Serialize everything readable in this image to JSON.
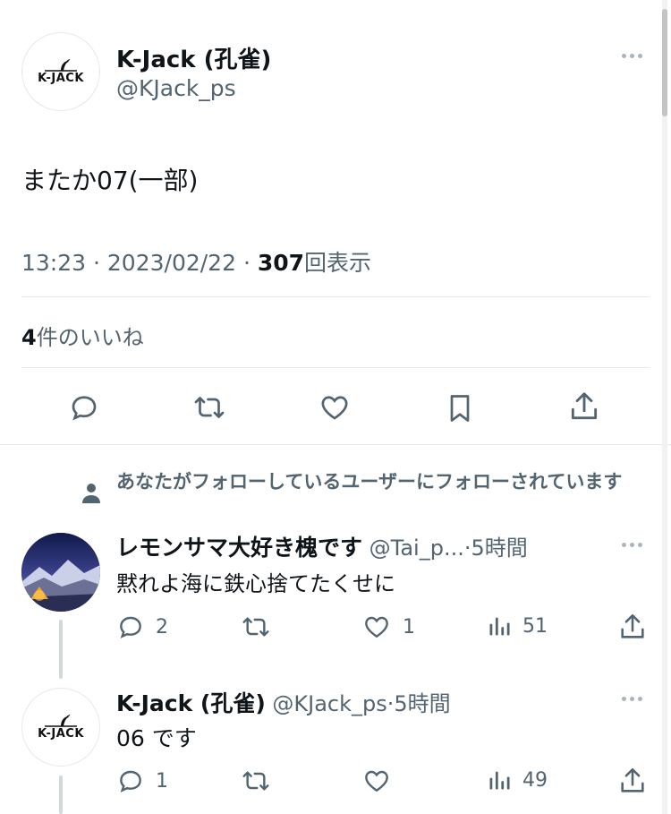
{
  "tweet": {
    "author_name": "K-Jack (孔雀)",
    "author_handle": "@KJack_ps",
    "avatar_logo_text": "K-JACK",
    "text": "またか07(一部)",
    "time": "13:23",
    "date": "2023/02/22",
    "views_count": "307",
    "views_label": "回表示",
    "separator": "·",
    "likes_count": "4",
    "likes_label": "件のいいね"
  },
  "replies": [
    {
      "context": "あなたがフォローしているユーザーにフォローされています",
      "author_name": "レモンサマ大好き槐です",
      "author_handle": "@Tai_p...",
      "separator": "·",
      "time_ago": "5時間",
      "text": "黙れよ海に鉄心捨てたくせに",
      "reply_count": "2",
      "like_count": "1",
      "view_count": "51"
    },
    {
      "author_name": "K-Jack (孔雀)",
      "author_handle": "@KJack_ps",
      "avatar_logo_text": "K-JACK",
      "separator": "·",
      "time_ago": "5時間",
      "text": "06 です",
      "reply_count": "1",
      "view_count": "49"
    }
  ],
  "colors": {
    "text": "#0f1419",
    "secondary": "#536471",
    "divider": "#e6e9ea",
    "thread_line": "#cfd9de"
  }
}
